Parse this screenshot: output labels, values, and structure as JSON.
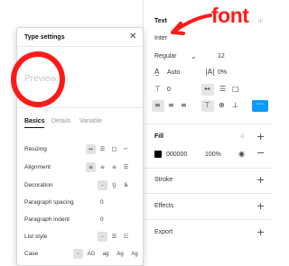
{
  "panel": {
    "text_section": {
      "title": "Text",
      "font_family": "Inter",
      "weight": "Regular",
      "size": "12",
      "line_height": "Auto",
      "letter_spacing": "0%",
      "paragraph_spacing": "0",
      "more_icon": "more-icon"
    },
    "fill_section": {
      "title": "Fill",
      "color_hex": "000000",
      "color_swatch": "#000000",
      "opacity": "100%"
    },
    "stroke_label": "Stroke",
    "effects_label": "Effects",
    "export_label": "Export"
  },
  "dialog": {
    "title": "Type settings",
    "preview": "Preview",
    "tabs": [
      "Basics",
      "Details",
      "Variable"
    ],
    "rows": [
      {
        "label": "Resizing"
      },
      {
        "label": "Alignment"
      },
      {
        "label": "Decoration",
        "value": "-"
      },
      {
        "label": "Paragraph spacing",
        "value": "0"
      },
      {
        "label": "Paragraph indent",
        "value": "0"
      },
      {
        "label": "List style",
        "value": "-"
      },
      {
        "label": "Case",
        "value": "-"
      }
    ],
    "case_options": [
      "AG",
      "ag",
      "Ag",
      "Ag"
    ]
  },
  "annotation": {
    "word": "font",
    "color": "#ff1a1a"
  },
  "colors": {
    "accent": "#0d99ff",
    "annotation": "#ff1a1a"
  }
}
